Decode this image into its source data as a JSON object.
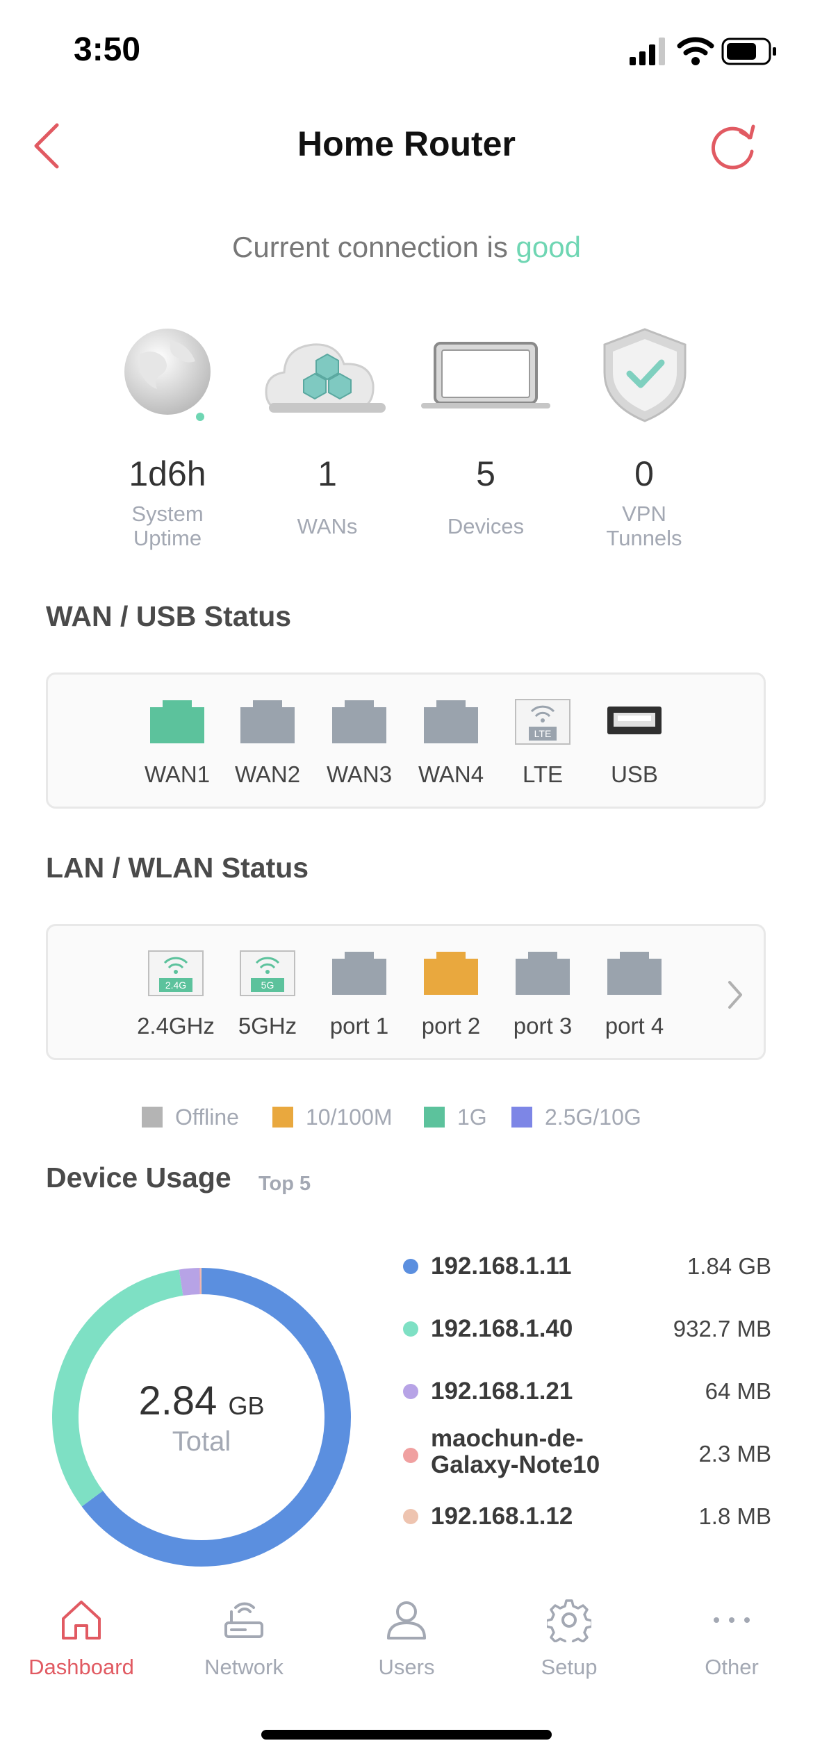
{
  "status_bar": {
    "time": "3:50"
  },
  "header": {
    "title": "Home Router"
  },
  "connection": {
    "prefix": "Current connection is",
    "quality": "good"
  },
  "stats": [
    {
      "value": "1d6h",
      "label_line1": "System",
      "label_line2": "Uptime",
      "icon": "globe-icon"
    },
    {
      "value": "1",
      "label_line1": "WANs",
      "label_line2": "",
      "icon": "cloud-icon"
    },
    {
      "value": "5",
      "label_line1": "Devices",
      "label_line2": "",
      "icon": "laptop-icon"
    },
    {
      "value": "0",
      "label_line1": "VPN",
      "label_line2": "Tunnels",
      "icon": "shield-icon"
    }
  ],
  "wan_section": {
    "title": "WAN / USB Status",
    "ports": [
      {
        "label": "WAN1",
        "state": "1G",
        "icon": "ethernet-port-icon"
      },
      {
        "label": "WAN2",
        "state": "Offline",
        "icon": "ethernet-port-icon"
      },
      {
        "label": "WAN3",
        "state": "Offline",
        "icon": "ethernet-port-icon"
      },
      {
        "label": "WAN4",
        "state": "Offline",
        "icon": "ethernet-port-icon"
      },
      {
        "label": "LTE",
        "state": "Offline",
        "icon": "lte-icon",
        "badge": "LTE"
      },
      {
        "label": "USB",
        "state": "Offline",
        "icon": "usb-port-icon"
      }
    ]
  },
  "lan_section": {
    "title": "LAN / WLAN Status",
    "ports": [
      {
        "label": "2.4GHz",
        "badge": "2.4G",
        "icon": "wifi-band-icon"
      },
      {
        "label": "5GHz",
        "badge": "5G",
        "icon": "wifi-band-icon"
      },
      {
        "label": "port 1",
        "state": "Offline",
        "icon": "ethernet-port-icon"
      },
      {
        "label": "port 2",
        "state": "10/100M",
        "icon": "ethernet-port-icon"
      },
      {
        "label": "port 3",
        "state": "Offline",
        "icon": "ethernet-port-icon"
      },
      {
        "label": "port 4",
        "state": "Offline",
        "icon": "ethernet-port-icon"
      }
    ]
  },
  "legend": [
    {
      "label": "Offline",
      "color": "#b4b4b4"
    },
    {
      "label": "10/100M",
      "color": "#e9a83e"
    },
    {
      "label": "1G",
      "color": "#5cc29c"
    },
    {
      "label": "2.5G/10G",
      "color": "#7d86e6"
    }
  ],
  "device_usage": {
    "title": "Device Usage",
    "subtitle": "Top 5",
    "total_value": "2.84",
    "total_unit": "GB",
    "total_label": "Total",
    "devices": [
      {
        "name": "192.168.1.11",
        "name2": "",
        "usage": "1.84 GB",
        "color": "#5b8fdf",
        "share": 0.648
      },
      {
        "name": "192.168.1.40",
        "name2": "",
        "usage": "932.7 MB",
        "color": "#7ee0c4",
        "share": 0.328
      },
      {
        "name": "192.168.1.21",
        "name2": "",
        "usage": "64 MB",
        "color": "#b7a3e6",
        "share": 0.022
      },
      {
        "name": "maochun-de-",
        "name2": "Galaxy-Note10",
        "usage": "2.3 MB",
        "color": "#f0a0a0",
        "share": 0.001
      },
      {
        "name": "192.168.1.12",
        "name2": "",
        "usage": "1.8 MB",
        "color": "#eec4b0",
        "share": 0.001
      }
    ]
  },
  "tabs": [
    {
      "label": "Dashboard",
      "icon": "home-icon",
      "active": true
    },
    {
      "label": "Network",
      "icon": "router-icon",
      "active": false
    },
    {
      "label": "Users",
      "icon": "user-icon",
      "active": false
    },
    {
      "label": "Setup",
      "icon": "gear-icon",
      "active": false
    },
    {
      "label": "Other",
      "icon": "more-icon",
      "active": false
    }
  ],
  "colors": {
    "accent": "#e15a62",
    "good": "#6fd6b3",
    "offline": "#9aa3ad",
    "port_1g": "#5cc29c",
    "port_100m": "#e9a83e"
  }
}
